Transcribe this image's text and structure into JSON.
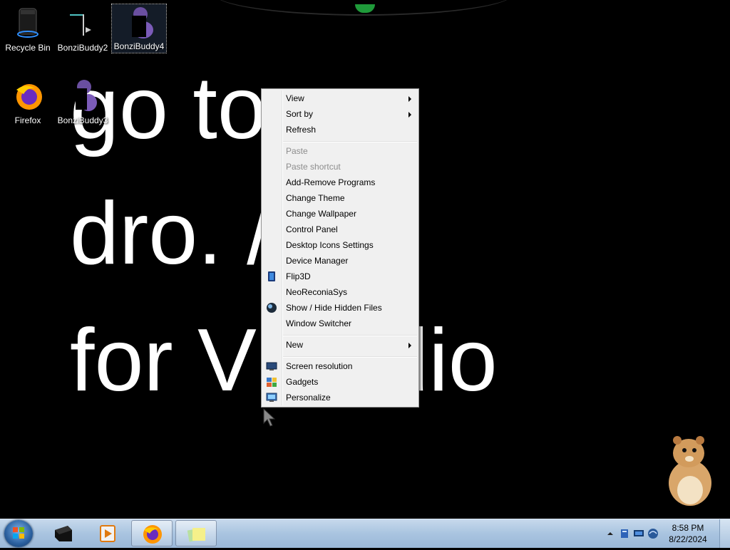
{
  "wallpaper": {
    "lines": [
      "go to",
      "dro.  /b",
      "for V  audio"
    ]
  },
  "desktop_icons": [
    {
      "label": "Recycle Bin",
      "icon": "recycle-bin-icon"
    },
    {
      "label": "BonziBuddy2",
      "icon": "bonzibuddy-icon"
    },
    {
      "label": "BonziBuddy4",
      "icon": "bonzibuddy-icon",
      "selected": true
    },
    {
      "label": "Firefox",
      "icon": "firefox-icon"
    },
    {
      "label": "BonziBuddy3",
      "icon": "bonzibuddy-icon"
    }
  ],
  "context_menu": {
    "items": [
      {
        "label": "View",
        "submenu": true
      },
      {
        "label": "Sort by",
        "submenu": true
      },
      {
        "label": "Refresh"
      },
      {
        "label": "Paste",
        "disabled": true
      },
      {
        "label": "Paste shortcut",
        "disabled": true
      },
      {
        "label": "Add-Remove Programs"
      },
      {
        "label": "Change Theme"
      },
      {
        "label": "Change Wallpaper"
      },
      {
        "label": "Control Panel"
      },
      {
        "label": "Desktop Icons Settings"
      },
      {
        "label": "Device Manager"
      },
      {
        "label": "Flip3D",
        "icon": "flip3d-icon"
      },
      {
        "label": "NeoReconiaSys"
      },
      {
        "label": "Show / Hide Hidden Files",
        "icon": "globe-icon"
      },
      {
        "label": "Window Switcher"
      },
      {
        "label": "New",
        "submenu": true
      },
      {
        "label": "Screen resolution",
        "icon": "screen-resolution-icon"
      },
      {
        "label": "Gadgets",
        "icon": "gadgets-icon"
      },
      {
        "label": "Personalize",
        "icon": "personalize-icon"
      }
    ]
  },
  "taskbar": {
    "pinned": [
      {
        "name": "terminal",
        "icon": "terminal-icon"
      },
      {
        "name": "media-player",
        "icon": "media-player-icon"
      },
      {
        "name": "firefox",
        "icon": "firefox-icon",
        "active": true
      },
      {
        "name": "sticky-notes",
        "icon": "sticky-notes-icon",
        "active": true
      }
    ],
    "clock": {
      "time": "8:58 PM",
      "date": "8/22/2024"
    },
    "tray_icons": [
      "show-hidden-icons-chevron",
      "action-center-icon",
      "display-icon",
      "network-icon"
    ]
  },
  "colors": {
    "menu_bg": "#f0f0f0",
    "taskbar": "#a9c4e0",
    "desktop": "#000000"
  }
}
